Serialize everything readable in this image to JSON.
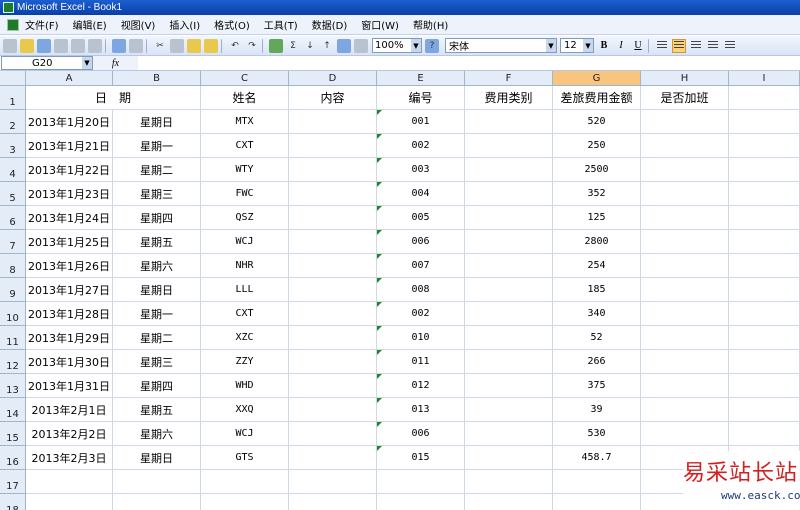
{
  "window": {
    "title": "Microsoft Excel - Book1"
  },
  "menu": [
    "文件(F)",
    "编辑(E)",
    "视图(V)",
    "插入(I)",
    "格式(O)",
    "工具(T)",
    "数据(D)",
    "窗口(W)",
    "帮助(H)"
  ],
  "toolbar": {
    "zoom": "100%",
    "font": "宋体",
    "font_size": "12",
    "sigma": "Σ",
    "undo_icon": "undo-icon"
  },
  "formula_bar": {
    "name_box": "G20",
    "fx_label": "fx",
    "content": ""
  },
  "sheet": {
    "columns": [
      "A",
      "B",
      "C",
      "D",
      "E",
      "F",
      "G",
      "H",
      "I"
    ],
    "selected_column": "G",
    "row_numbers": [
      "1",
      "2",
      "3",
      "4",
      "5",
      "6",
      "7",
      "8",
      "9",
      "10",
      "11",
      "12",
      "13",
      "14",
      "15",
      "16",
      "17",
      "18"
    ],
    "headers": {
      "date": "日　期",
      "name": "姓名",
      "content": "内容",
      "code": "编号",
      "expense_type": "费用类别",
      "travel_amount": "差旅费用金额",
      "overtime": "是否加班"
    },
    "rows": [
      {
        "date": "2013年1月20日",
        "weekday": "星期日",
        "name": "MTX",
        "code": "001",
        "amount": "520"
      },
      {
        "date": "2013年1月21日",
        "weekday": "星期一",
        "name": "CXT",
        "code": "002",
        "amount": "250"
      },
      {
        "date": "2013年1月22日",
        "weekday": "星期二",
        "name": "WTY",
        "code": "003",
        "amount": "2500"
      },
      {
        "date": "2013年1月23日",
        "weekday": "星期三",
        "name": "FWC",
        "code": "004",
        "amount": "352"
      },
      {
        "date": "2013年1月24日",
        "weekday": "星期四",
        "name": "QSZ",
        "code": "005",
        "amount": "125"
      },
      {
        "date": "2013年1月25日",
        "weekday": "星期五",
        "name": "WCJ",
        "code": "006",
        "amount": "2800"
      },
      {
        "date": "2013年1月26日",
        "weekday": "星期六",
        "name": "NHR",
        "code": "007",
        "amount": "254"
      },
      {
        "date": "2013年1月27日",
        "weekday": "星期日",
        "name": "LLL",
        "code": "008",
        "amount": "185"
      },
      {
        "date": "2013年1月28日",
        "weekday": "星期一",
        "name": "CXT",
        "code": "002",
        "amount": "340"
      },
      {
        "date": "2013年1月29日",
        "weekday": "星期二",
        "name": "XZC",
        "code": "010",
        "amount": "52"
      },
      {
        "date": "2013年1月30日",
        "weekday": "星期三",
        "name": "ZZY",
        "code": "011",
        "amount": "266"
      },
      {
        "date": "2013年1月31日",
        "weekday": "星期四",
        "name": "WHD",
        "code": "012",
        "amount": "375"
      },
      {
        "date": "2013年2月1日",
        "weekday": "星期五",
        "name": "XXQ",
        "code": "013",
        "amount": "39"
      },
      {
        "date": "2013年2月2日",
        "weekday": "星期六",
        "name": "WCJ",
        "code": "006",
        "amount": "530"
      },
      {
        "date": "2013年2月3日",
        "weekday": "星期日",
        "name": "GTS",
        "code": "015",
        "amount": "458.7"
      }
    ]
  },
  "watermark": {
    "text_cn": "易采站长站",
    "url": "www.easck.com"
  },
  "colors": {
    "title_bar": "#0a3ea8",
    "selected_header": "#f9c57e",
    "header_bg": "#e4ecf7",
    "gridline": "#d0d7e5",
    "text_marker": "#1d8a2a",
    "watermark_red": "#d41f1f"
  }
}
